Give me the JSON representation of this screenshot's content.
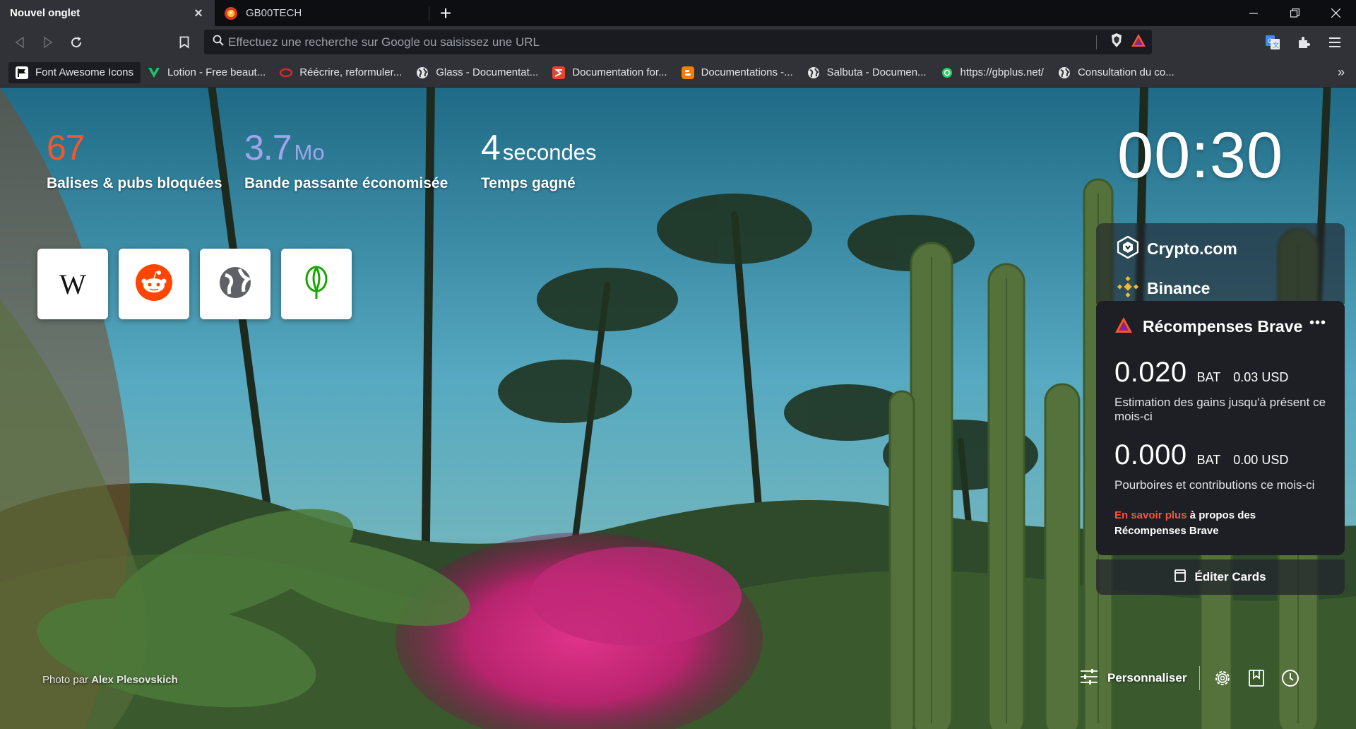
{
  "tabs": [
    {
      "title": "Nouvel onglet",
      "active": true
    },
    {
      "title": "GB00TECH",
      "active": false
    }
  ],
  "toolbar": {
    "search_placeholder": "Effectuez une recherche sur Google ou saisissez une URL"
  },
  "bookmarks": [
    {
      "label": "Font Awesome Icons",
      "icon": "flag-icon",
      "color": "#1c1d22"
    },
    {
      "label": "Lotion - Free beaut...",
      "icon": "lotion-v-icon",
      "color": "#21c26b"
    },
    {
      "label": "Réécrire, reformuler...",
      "icon": "reecrire-icon",
      "color": "#d42a2a"
    },
    {
      "label": "Glass - Documentat...",
      "icon": "globe-icon",
      "color": "#e6e6e6"
    },
    {
      "label": "Documentation for...",
      "icon": "documentation-s-icon",
      "color": "#e8452c"
    },
    {
      "label": "Documentations -...",
      "icon": "blogger-icon",
      "color": "#f57d00"
    },
    {
      "label": "Salbuta - Documen...",
      "icon": "globe-icon",
      "color": "#e6e6e6"
    },
    {
      "label": "https://gbplus.net/",
      "icon": "whatsapp-icon",
      "color": "#25d366"
    },
    {
      "label": "Consultation du co...",
      "icon": "globe-icon",
      "color": "#e6e6e6"
    }
  ],
  "stats": {
    "trackers": {
      "value": "67",
      "label": "Balises & pubs bloquées",
      "color": "#fb542b"
    },
    "bandwidth": {
      "value": "3.7",
      "unit": "Mo",
      "label": "Bande passante économisée",
      "color": "#a0a5eb"
    },
    "time": {
      "value": "4",
      "unit": "secondes",
      "label": "Temps gagné",
      "color": "#ffffff"
    }
  },
  "clock": "00:30",
  "top_sites": [
    {
      "name": "wikipedia",
      "icon": "wikipedia-icon"
    },
    {
      "name": "reddit",
      "icon": "reddit-icon"
    },
    {
      "name": "globe",
      "icon": "globe-icon"
    },
    {
      "name": "upwork",
      "icon": "upwork-icon"
    }
  ],
  "widgets": {
    "crypto_com": "Crypto.com",
    "binance": "Binance"
  },
  "rewards": {
    "title": "Récompenses Brave",
    "more": "•••",
    "earnings_value": "0.020",
    "earnings_bat": "BAT",
    "earnings_usd": "0.03 USD",
    "earnings_desc": "Estimation des gains jusqu'à présent ce mois-ci",
    "tips_value": "0.000",
    "tips_bat": "BAT",
    "tips_usd": "0.00 USD",
    "tips_desc": "Pourboires et contributions ce mois-ci",
    "learn_link": "En savoir plus",
    "learn_rest": " à propos des Récompenses Brave",
    "accent": "#fb542b"
  },
  "edit_cards": "Éditer Cards",
  "photo": {
    "prefix": "Photo par ",
    "author": "Alex Plesovskich"
  },
  "footer": {
    "personalize": "Personnaliser"
  }
}
